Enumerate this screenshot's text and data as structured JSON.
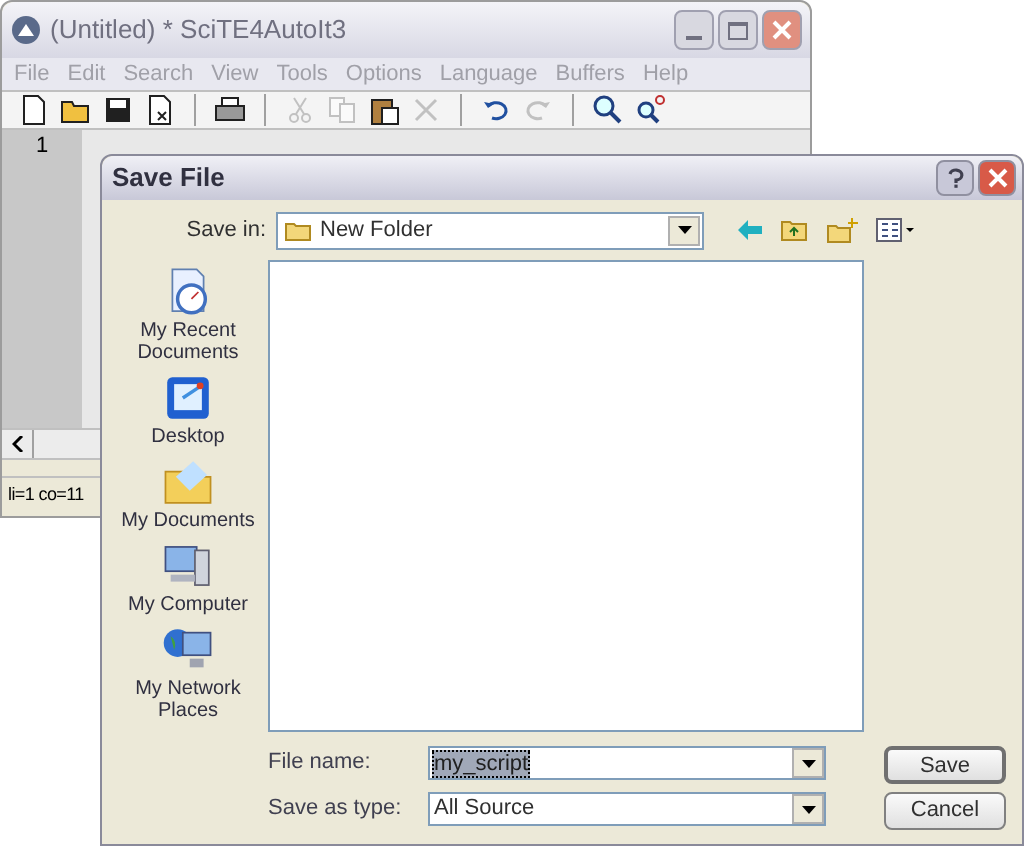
{
  "editor": {
    "title": "(Untitled) * SciTE4AutoIt3",
    "menu": [
      "File",
      "Edit",
      "Search",
      "View",
      "Tools",
      "Options",
      "Language",
      "Buffers",
      "Help"
    ],
    "toolbar_groups": [
      [
        {
          "kind": "new",
          "disabled": false
        },
        {
          "kind": "open",
          "disabled": false
        },
        {
          "kind": "save",
          "disabled": false
        },
        {
          "kind": "close",
          "disabled": false
        }
      ],
      [
        {
          "kind": "print",
          "disabled": false
        }
      ],
      [
        {
          "kind": "cut",
          "disabled": true
        },
        {
          "kind": "copy",
          "disabled": true
        },
        {
          "kind": "paste",
          "disabled": false
        },
        {
          "kind": "delete",
          "disabled": true
        }
      ],
      [
        {
          "kind": "undo",
          "disabled": false
        },
        {
          "kind": "redo",
          "disabled": true
        }
      ],
      [
        {
          "kind": "find",
          "disabled": false
        },
        {
          "kind": "replace",
          "disabled": false
        }
      ]
    ],
    "line_number": "1",
    "status": "li=1 co=11"
  },
  "dialog": {
    "title": "Save File",
    "save_in_label": "Save in:",
    "save_in_value": "New Folder",
    "places": [
      {
        "kind": "recent",
        "label": "My Recent Documents"
      },
      {
        "kind": "desktop",
        "label": "Desktop"
      },
      {
        "kind": "documents",
        "label": "My Documents"
      },
      {
        "kind": "computer",
        "label": "My Computer"
      },
      {
        "kind": "network",
        "label": "My Network Places"
      }
    ],
    "file_name_label": "File name:",
    "file_name_value": "my_script",
    "type_label": "Save as type:",
    "type_value": "All Source",
    "buttons": [
      "Save",
      "Cancel"
    ]
  }
}
